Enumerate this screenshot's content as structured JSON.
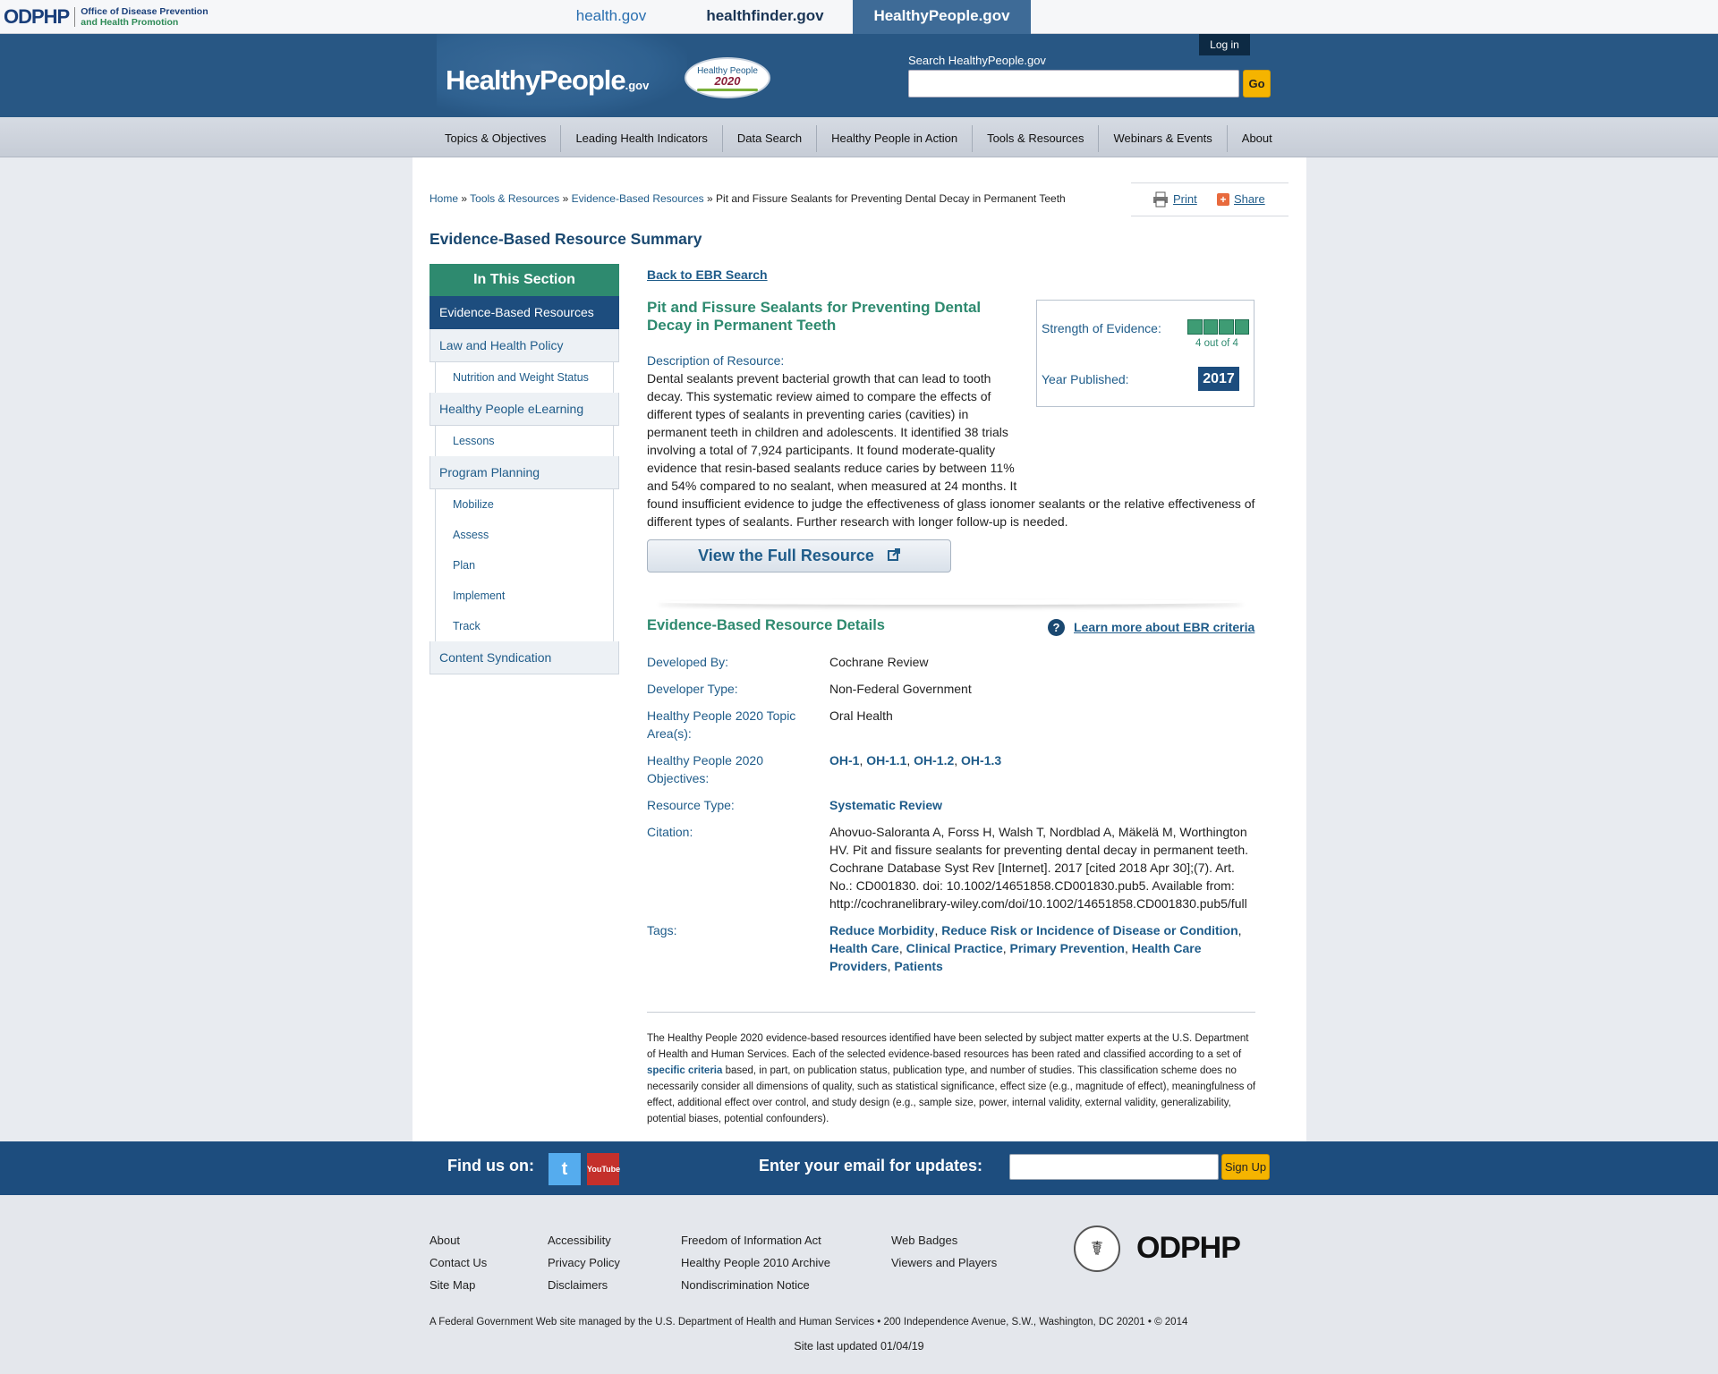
{
  "top_bar": {
    "odphp_mark": "ODPHP",
    "odphp_line1": "Office of Disease Prevention",
    "odphp_line2": "and Health Promotion",
    "sites": [
      "health.gov",
      "healthfinder.gov",
      "HealthyPeople.gov"
    ]
  },
  "header": {
    "logo_text": "HealthyPeople",
    "logo_suffix": ".gov",
    "badge_line1": "Healthy People",
    "badge_line2": "2020",
    "login_label": "Log in",
    "search_label": "Search HealthyPeople.gov",
    "search_value": "",
    "go_label": "Go"
  },
  "nav": [
    "Topics & Objectives",
    "Leading Health Indicators",
    "Data Search",
    "Healthy People in Action",
    "Tools & Resources",
    "Webinars & Events",
    "About"
  ],
  "breadcrumb": {
    "home": "Home",
    "sep": "»",
    "tools": "Tools & Resources",
    "ebr": "Evidence-Based Resources",
    "current": "Pit and Fissure Sealants for Preventing Dental Decay in Permanent Teeth"
  },
  "utility": {
    "print": "Print",
    "share": "Share"
  },
  "page_title": "Evidence-Based Resource Summary",
  "sidebar": {
    "header": "In This Section",
    "items": [
      {
        "label": "Evidence-Based Resources",
        "active": true,
        "subs": []
      },
      {
        "label": "Law and Health Policy",
        "subs": [
          "Nutrition and Weight Status"
        ]
      },
      {
        "label": "Healthy People eLearning",
        "subs": [
          "Lessons"
        ]
      },
      {
        "label": "Program Planning",
        "subs": [
          "Mobilize",
          "Assess",
          "Plan",
          "Implement",
          "Track"
        ]
      },
      {
        "label": "Content Syndication",
        "subs": []
      }
    ]
  },
  "resource": {
    "back_link": "Back to EBR Search",
    "title": "Pit and Fissure Sealants for Preventing Dental Decay in Permanent Teeth",
    "desc_label": "Description of Resource:",
    "description": "Dental sealants prevent bacterial growth that can lead to tooth decay. This systematic review aimed to compare the effects of different types of sealants in preventing caries (cavities) in permanent teeth in children and adolescents. It identified 38 trials involving a total of 7,924 participants. It found moderate-quality evidence that resin-based sealants reduce caries by between 11% and 54% compared to no sealant, when measured at 24 months. It found insufficient evidence to judge the effectiveness of glass ionomer sealants or the relative effectiveness of different types of sealants. Further research with longer follow-up is needed.",
    "strength_label": "Strength of Evidence:",
    "strength_value": 4,
    "strength_max": 4,
    "strength_text": "4 out of 4",
    "year_label": "Year Published:",
    "year": "2017",
    "view_button": "View the Full Resource"
  },
  "details": {
    "title": "Evidence-Based Resource Details",
    "learn_more": "Learn more about EBR criteria",
    "developed_by_label": "Developed By:",
    "developed_by": "Cochrane Review",
    "developer_type_label": "Developer Type:",
    "developer_type": "Non-Federal Government",
    "topic_label": "Healthy People 2020 Topic Area(s):",
    "topic": "Oral Health",
    "objectives_label": "Healthy People 2020 Objectives:",
    "objectives": [
      "OH-1",
      "OH-1.1",
      "OH-1.2",
      "OH-1.3"
    ],
    "resource_type_label": "Resource Type:",
    "resource_type": "Systematic Review",
    "citation_label": "Citation:",
    "citation": "Ahovuo-Saloranta A, Forss H, Walsh T, Nordblad A, Mäkelä M, Worthington HV. Pit and fissure sealants for preventing dental decay in permanent teeth. Cochrane Database Syst Rev [Internet]. 2017 [cited 2018 Apr 30];(7). Art. No.: CD001830. doi: 10.1002/14651858.CD001830.pub5. Available from: http://cochranelibrary-wiley.com/doi/10.1002/14651858.CD001830.pub5/full",
    "tags_label": "Tags:",
    "tags": [
      "Reduce Morbidity",
      "Reduce Risk or Incidence of Disease or Condition",
      "Health Care",
      "Clinical Practice",
      "Primary Prevention",
      "Health Care Providers",
      "Patients"
    ]
  },
  "disclaimer": {
    "before": "The Healthy People 2020 evidence-based resources identified have been selected by subject matter experts at the U.S. Department of Health and Human Services. Each of the selected evidence-based resources has been rated and classified according to a set of ",
    "link": "specific criteria",
    "after": " based, in part, on publication status, publication type, and number of studies. This classification scheme does no necessarily consider all dimensions of quality, such as statistical significance, effect size (e.g., magnitude of effect), meaningfulness of effect, additional effect over control, and study design (e.g., sample size, power, internal validity, external validity, generalizability, potential biases, potential confounders)."
  },
  "find_bar": {
    "find_label": "Find us on:",
    "twitter_icon": "twitter-icon",
    "youtube_text": "YouTube",
    "email_label": "Enter your email for updates:",
    "email_value": "",
    "signup_label": "Sign Up"
  },
  "footer": {
    "col1": [
      "About",
      "Contact Us",
      "Site Map"
    ],
    "col2": [
      "Accessibility",
      "Privacy Policy",
      "Disclaimers"
    ],
    "col3": [
      "Freedom of Information Act",
      "Healthy People 2010 Archive",
      "Nondiscrimination Notice"
    ],
    "col4": [
      "Web Badges",
      "Viewers and Players"
    ],
    "logo": "ODPHP",
    "note": "A Federal Government Web site managed by the U.S. Department of Health and Human Services • 200 Independence Avenue, S.W., Washington, DC 20201 • © 2014",
    "updated": "Site last updated 01/04/19"
  },
  "colors": {
    "brand_blue": "#285784",
    "accent_green": "#2e8a6f",
    "accent_yellow": "#f5b400"
  }
}
